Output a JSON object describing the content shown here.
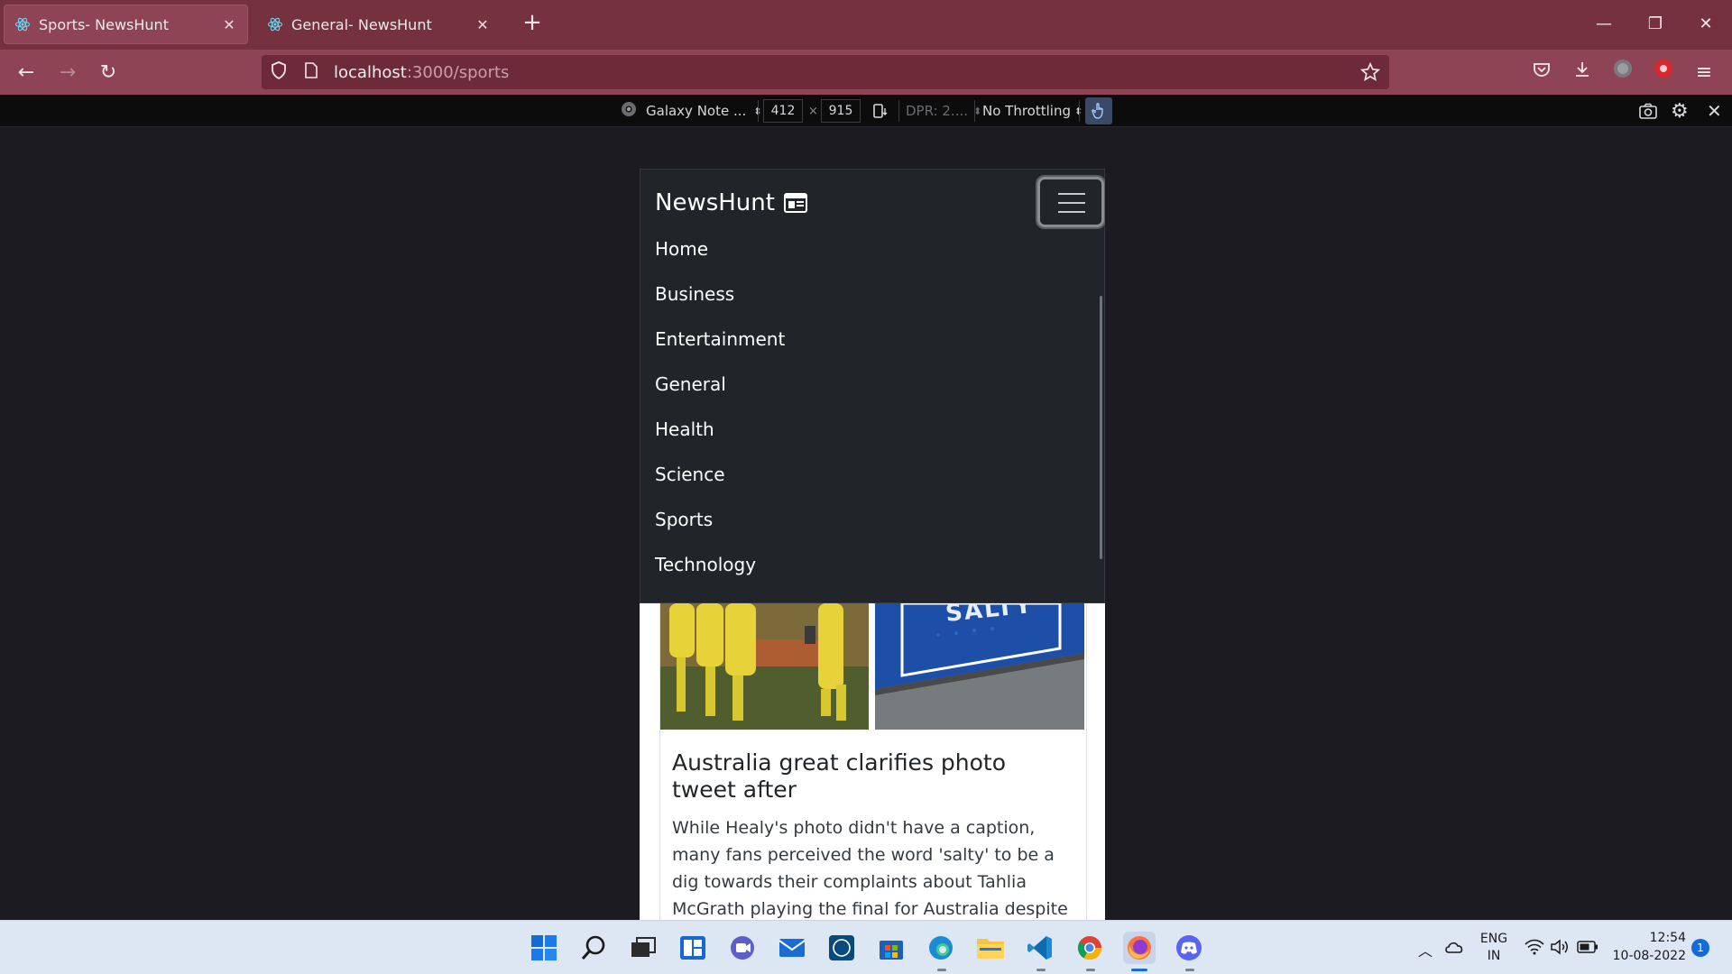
{
  "browser": {
    "tabs": [
      {
        "title": "Sports- NewsHunt",
        "active": true
      },
      {
        "title": "General- NewsHunt",
        "active": false
      }
    ],
    "url_host": "localhost",
    "url_path": ":3000/sports"
  },
  "rdm": {
    "device": "Galaxy Note ...",
    "width": "412",
    "times": "×",
    "height": "915",
    "dpr": "DPR: 2....",
    "throttling": "No Throttling"
  },
  "site": {
    "brand": "NewsHunt",
    "nav": [
      "Home",
      "Business",
      "Entertainment",
      "General",
      "Health",
      "Science",
      "Sports",
      "Technology"
    ],
    "image_word": "SALTY",
    "card_title": "Australia great clarifies photo tweet after",
    "card_text": "While Healy's photo didn't have a caption, many fans perceived the word 'salty' to be a dig towards their complaints about Tahlia McGrath playing the final for Australia despite testing"
  },
  "taskbar": {
    "lang_top": "ENG",
    "lang_bottom": "IN",
    "time": "12:54",
    "date": "10-08-2022",
    "notification_count": "1"
  },
  "colors": {
    "tab_strip": "#76313f",
    "toolbar": "#8e4454",
    "site_nav": "#212529"
  }
}
